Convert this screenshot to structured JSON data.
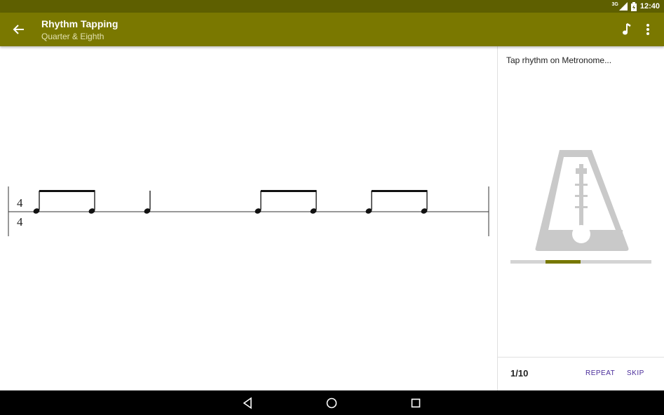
{
  "status_bar": {
    "network": "3G",
    "time": "12:40"
  },
  "app_bar": {
    "title": "Rhythm Tapping",
    "subtitle": "Quarter & Eighth",
    "back_icon": "arrow-left-icon",
    "action_icons": [
      "music-note-icon",
      "more-vert-icon"
    ]
  },
  "score": {
    "time_signature": {
      "top": "4",
      "bottom": "4"
    },
    "notes": [
      "eighth",
      "eighth",
      "quarter",
      "eighth",
      "eighth",
      "eighth",
      "eighth"
    ]
  },
  "side_panel": {
    "prompt": "Tap rhythm on Metronome...",
    "metronome_icon": "metronome-icon",
    "progress": 0.25,
    "counter": "1/10",
    "repeat_label": "REPEAT",
    "skip_label": "SKIP"
  },
  "colors": {
    "status_bar": "#5e5f00",
    "app_bar": "#7a7800",
    "accent_text": "#4a2c9a",
    "progress_fill": "#777800"
  },
  "nav_bar": {
    "icons": [
      "back-triangle-icon",
      "home-circle-icon",
      "recents-square-icon"
    ]
  }
}
